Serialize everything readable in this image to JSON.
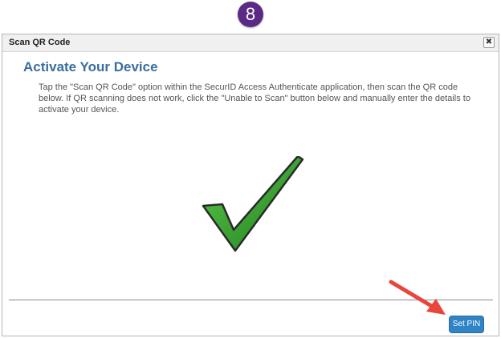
{
  "step_badge": {
    "number": "8",
    "color": "#5b2a86"
  },
  "dialog": {
    "title": "Scan QR Code",
    "close_symbol": "✖",
    "heading": "Activate Your Device",
    "instructions": "Tap the \"Scan QR Code\" option within the SecurID Access Authenticate application, then scan the QR code below. If QR scanning does not work, click the \"Unable to Scan\" button below and manually enter the details to activate your device.",
    "heading_color": "#3a6d9e",
    "success_icon": "green-checkmark-icon",
    "success_color": "#2e9e2e"
  },
  "footer": {
    "set_pin_label": "Set PIN",
    "button_color": "#2e84c5"
  },
  "annotation": {
    "arrow_icon": "red-arrow-icon",
    "arrow_color": "#e8453c"
  }
}
